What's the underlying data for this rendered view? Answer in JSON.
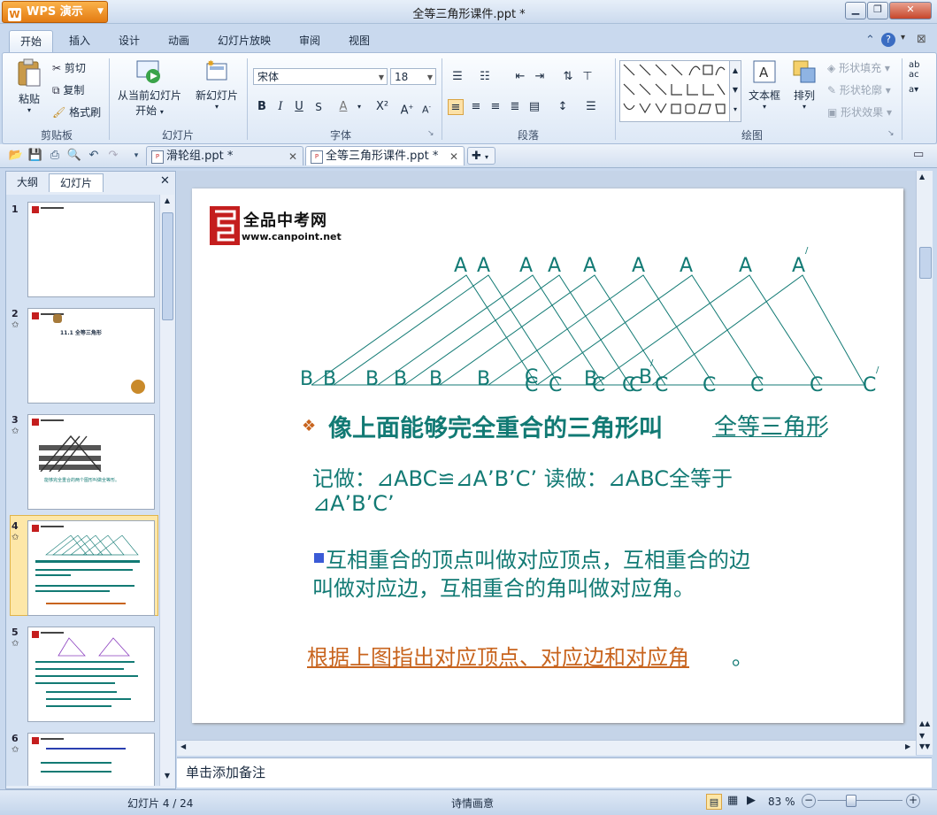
{
  "app": {
    "menu_label": "WPS 演示",
    "window_title": "全等三角形课件.ppt *"
  },
  "ribbon": {
    "tabs": [
      "开始",
      "插入",
      "设计",
      "动画",
      "幻灯片放映",
      "审阅",
      "视图"
    ],
    "clipboard": {
      "paste": "粘贴",
      "cut": "剪切",
      "copy": "复制",
      "format_painter": "格式刷",
      "group": "剪贴板"
    },
    "slides": {
      "from_current_1": "从当前幻灯片",
      "from_current_2": "开始",
      "new_slide": "新幻灯片",
      "group": "幻灯片"
    },
    "font": {
      "name": "宋体",
      "size": "18",
      "group": "字体"
    },
    "paragraph": {
      "group": "段落"
    },
    "drawing": {
      "textbox": "文本框",
      "arrange": "排列",
      "shape_fill": "形状填充",
      "shape_outline": "形状轮廓",
      "shape_effect": "形状效果",
      "group": "绘图"
    }
  },
  "doc_tabs": [
    {
      "label": "滑轮组.ppt *",
      "active": false
    },
    {
      "label": "全等三角形课件.ppt *",
      "active": true
    }
  ],
  "panel": {
    "tab_outline": "大纲",
    "tab_slides": "幻灯片"
  },
  "thumbnails": [
    {
      "number": "1",
      "caption": ""
    },
    {
      "number": "2",
      "caption": "11.1 全等三角形"
    },
    {
      "number": "3",
      "caption": "能够完全重合的两个图形叫做全等形。"
    },
    {
      "number": "4",
      "caption": ""
    },
    {
      "number": "5",
      "caption": ""
    },
    {
      "number": "6",
      "caption": ""
    }
  ],
  "slide": {
    "logo_text": "全品中考网",
    "logo_url": "www.canpoint.net",
    "top_labels": [
      "A",
      "A",
      "A",
      "A",
      "A",
      "A",
      "A",
      "A",
      "A"
    ],
    "bottom_labels": [
      "B",
      "B",
      "B",
      "B",
      "B",
      "B",
      "C",
      "C",
      "C",
      "B",
      "C",
      "C",
      "C",
      "B",
      "C",
      "C",
      "C",
      "C",
      "C",
      "B"
    ],
    "bullet_main": "像上面能够完全重合的三角形叫",
    "bullet_blank": "全等三角形",
    "notation_1": "记做：⊿ABC≌⊿A’B’C’ 读做：⊿ABC全等于",
    "notation_2": "⊿A’B’C’",
    "corr_1": "互相重合的顶点叫做对应顶点，互相重合的边",
    "corr_2": "叫做对应边，互相重合的角叫做对应角。",
    "task": "根据上图指出对应顶点、对应边和对应角",
    "task_end": "。"
  },
  "notes_placeholder": "单击添加备注",
  "status": {
    "slide_pos": "幻灯片 4 / 24",
    "theme": "诗情画意",
    "zoom": "83 %"
  },
  "colors": {
    "accent": "#127a74",
    "task": "#c8641e",
    "bullet_blue": "#3b5bd6"
  }
}
